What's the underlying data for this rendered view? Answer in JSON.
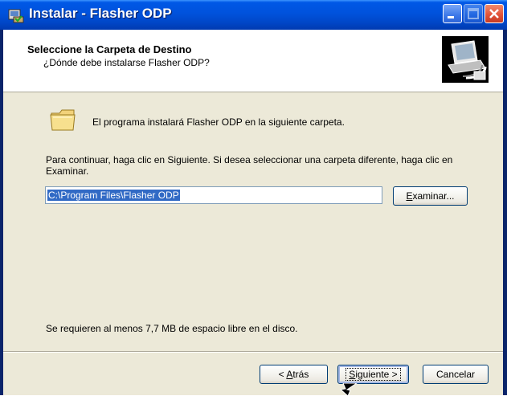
{
  "window": {
    "title": "Instalar - Flasher ODP"
  },
  "header": {
    "title": "Seleccione la Carpeta de Destino",
    "subtitle": "¿Dónde debe instalarse Flasher ODP?"
  },
  "body": {
    "intro": "El programa instalará Flasher ODP en la siguiente carpeta.",
    "instructions": "Para continuar, haga clic en Siguiente. Si desea seleccionar una carpeta diferente, haga clic en Examinar.",
    "path_value": "C:\\Program Files\\Flasher ODP",
    "browse_label_pre": "",
    "browse_label_key": "E",
    "browse_label_post": "xaminar...",
    "space_required": "Se requieren al menos 7,7 MB de espacio libre en el disco."
  },
  "footer": {
    "back_pre": "< ",
    "back_key": "A",
    "back_post": "trás",
    "next_key": "S",
    "next_post": "iguiente >",
    "cancel_label": "Cancelar"
  },
  "icons": [
    "installer-app-icon",
    "minimize-icon",
    "maximize-icon",
    "close-icon",
    "computer-installer-icon",
    "folder-icon",
    "mouse-cursor-icon"
  ],
  "colors": {
    "titlebar": "#0054e3",
    "dialog_bg": "#ece9d8",
    "selection": "#316ac5"
  }
}
